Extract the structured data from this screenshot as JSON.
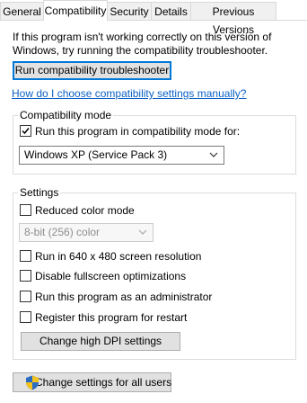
{
  "tabs": [
    {
      "label": "General"
    },
    {
      "label": "Compatibility"
    },
    {
      "label": "Security"
    },
    {
      "label": "Details"
    },
    {
      "label": "Previous Versions"
    }
  ],
  "intro_text": "If this program isn't working correctly on this version of Windows, try running the compatibility troubleshooter.",
  "run_troubleshooter_label": "Run compatibility troubleshooter",
  "help_link": "How do I choose compatibility settings manually?",
  "compat_mode": {
    "legend": "Compatibility mode",
    "checkbox_label": "Run this program in compatibility mode for:",
    "checked": true,
    "selected_os": "Windows XP (Service Pack 3)"
  },
  "settings": {
    "legend": "Settings",
    "reduced_color_label": "Reduced color mode",
    "color_depth_value": "8-bit (256) color",
    "res_640_label": "Run in 640 x 480 screen resolution",
    "disable_fullscreen_label": "Disable fullscreen optimizations",
    "run_admin_label": "Run this program as an administrator",
    "register_restart_label": "Register this program for restart",
    "dpi_button_label": "Change high DPI settings"
  },
  "all_users_button_label": "Change settings for all users",
  "colors": {
    "link": "#0b61c4",
    "focus_border": "#0078d7",
    "shield_blue": "#2b6cc4",
    "shield_yellow": "#f4c21d"
  }
}
